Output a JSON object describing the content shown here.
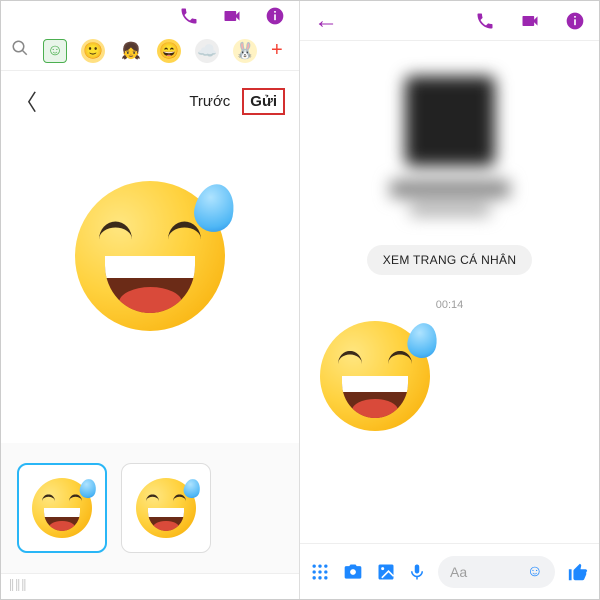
{
  "colors": {
    "accent": "#9c27b0",
    "composer": "#1e88ff",
    "highlight": "#d32f2f"
  },
  "left": {
    "header": {
      "icons": [
        "phone-icon",
        "video-icon",
        "info-icon"
      ]
    },
    "packs": {
      "search_icon": "search-icon",
      "items": [
        "pack-green",
        "pack-yellow",
        "pack-face",
        "pack-grin-selected",
        "pack-gray",
        "pack-bunny"
      ],
      "add_label": "+"
    },
    "bar": {
      "back_icon": "chevron-left-icon",
      "prev_label": "Trước",
      "send_label": "Gửi"
    },
    "thumbs": {
      "selected_index": 0
    }
  },
  "right": {
    "header": {
      "back_icon": "arrow-left-icon",
      "icons": [
        "phone-icon",
        "video-icon",
        "info-icon"
      ]
    },
    "profile": {
      "view_profile_label": "XEM TRANG CÁ NHÂN"
    },
    "timestamp": "00:14",
    "composer": {
      "icons": [
        "apps-icon",
        "camera-icon",
        "gallery-icon",
        "mic-icon"
      ],
      "placeholder": "Aa",
      "emoji_icon": "smile-icon",
      "like_icon": "thumbs-up-icon"
    }
  }
}
